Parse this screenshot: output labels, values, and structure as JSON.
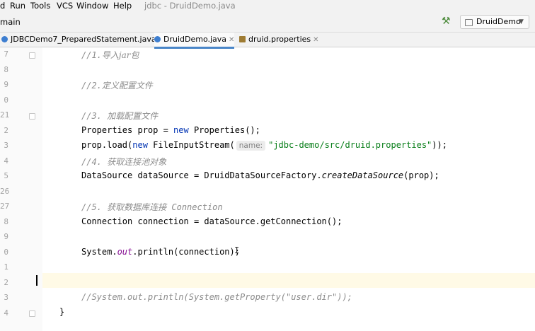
{
  "menu": {
    "items": [
      "d",
      "Run",
      "Tools",
      "VCS",
      "Window",
      "Help"
    ],
    "title": "jdbc - DruidDemo.java"
  },
  "nav": {
    "crumb": "main",
    "run_config": "DruidDemo"
  },
  "tabs": [
    {
      "label": "JDBCDemo7_PreparedStatement.java",
      "icon": "java-class-icon",
      "color": "#3d7ed0"
    },
    {
      "label": "DruidDemo.java",
      "icon": "java-class-icon",
      "color": "#3d7ed0"
    },
    {
      "label": "druid.properties",
      "icon": "properties-icon",
      "color": "#9e7b32"
    }
  ],
  "gutter": {
    "line_numbers": [
      "7",
      "8",
      "9",
      "0",
      "21",
      "2",
      "3",
      "4",
      "5",
      "26",
      "27",
      "8",
      "9",
      "0",
      "1",
      "2",
      "3",
      "4"
    ]
  },
  "code": {
    "c1": "//1.",
    "c1_cn": "导入jar包",
    "c2": "//2.",
    "c2_cn": "定义配置文件",
    "c3": "//3. ",
    "c3_cn": "加载配置文件",
    "l4a": "Properties prop = ",
    "l4_new": "new",
    "l4b": " Properties();",
    "l5a": "prop.load(",
    "l5_new": "new",
    "l5b": " FileInputStream(",
    "l5_hint": "name:",
    "l5_str": "\"jdbc-demo/src/druid.properties\"",
    "l5c": "));",
    "c4": "//4. ",
    "c4_cn": "获取连接池对象",
    "l6a": "DataSource dataSource = DruidDataSourceFactory.",
    "l6_call": "createDataSource",
    "l6b": "(prop);",
    "c5": "//5. ",
    "c5_cn": "获取数据库连接",
    "c5_tail": " Connection",
    "l7": "Connection connection = dataSource.getConnection();",
    "l8a": "System.",
    "l8_out": "out",
    "l8b": ".println(connection);",
    "c6": "//System.out.println(System.getProperty(\"user.dir\"));",
    "close_brace": "}"
  },
  "colors": {
    "keyword": "#0033b3",
    "string": "#067d17",
    "comment": "#8c8c8c",
    "static_field": "#871094",
    "tab_underline": "#4a86c8",
    "current_line": "#fffae6"
  }
}
